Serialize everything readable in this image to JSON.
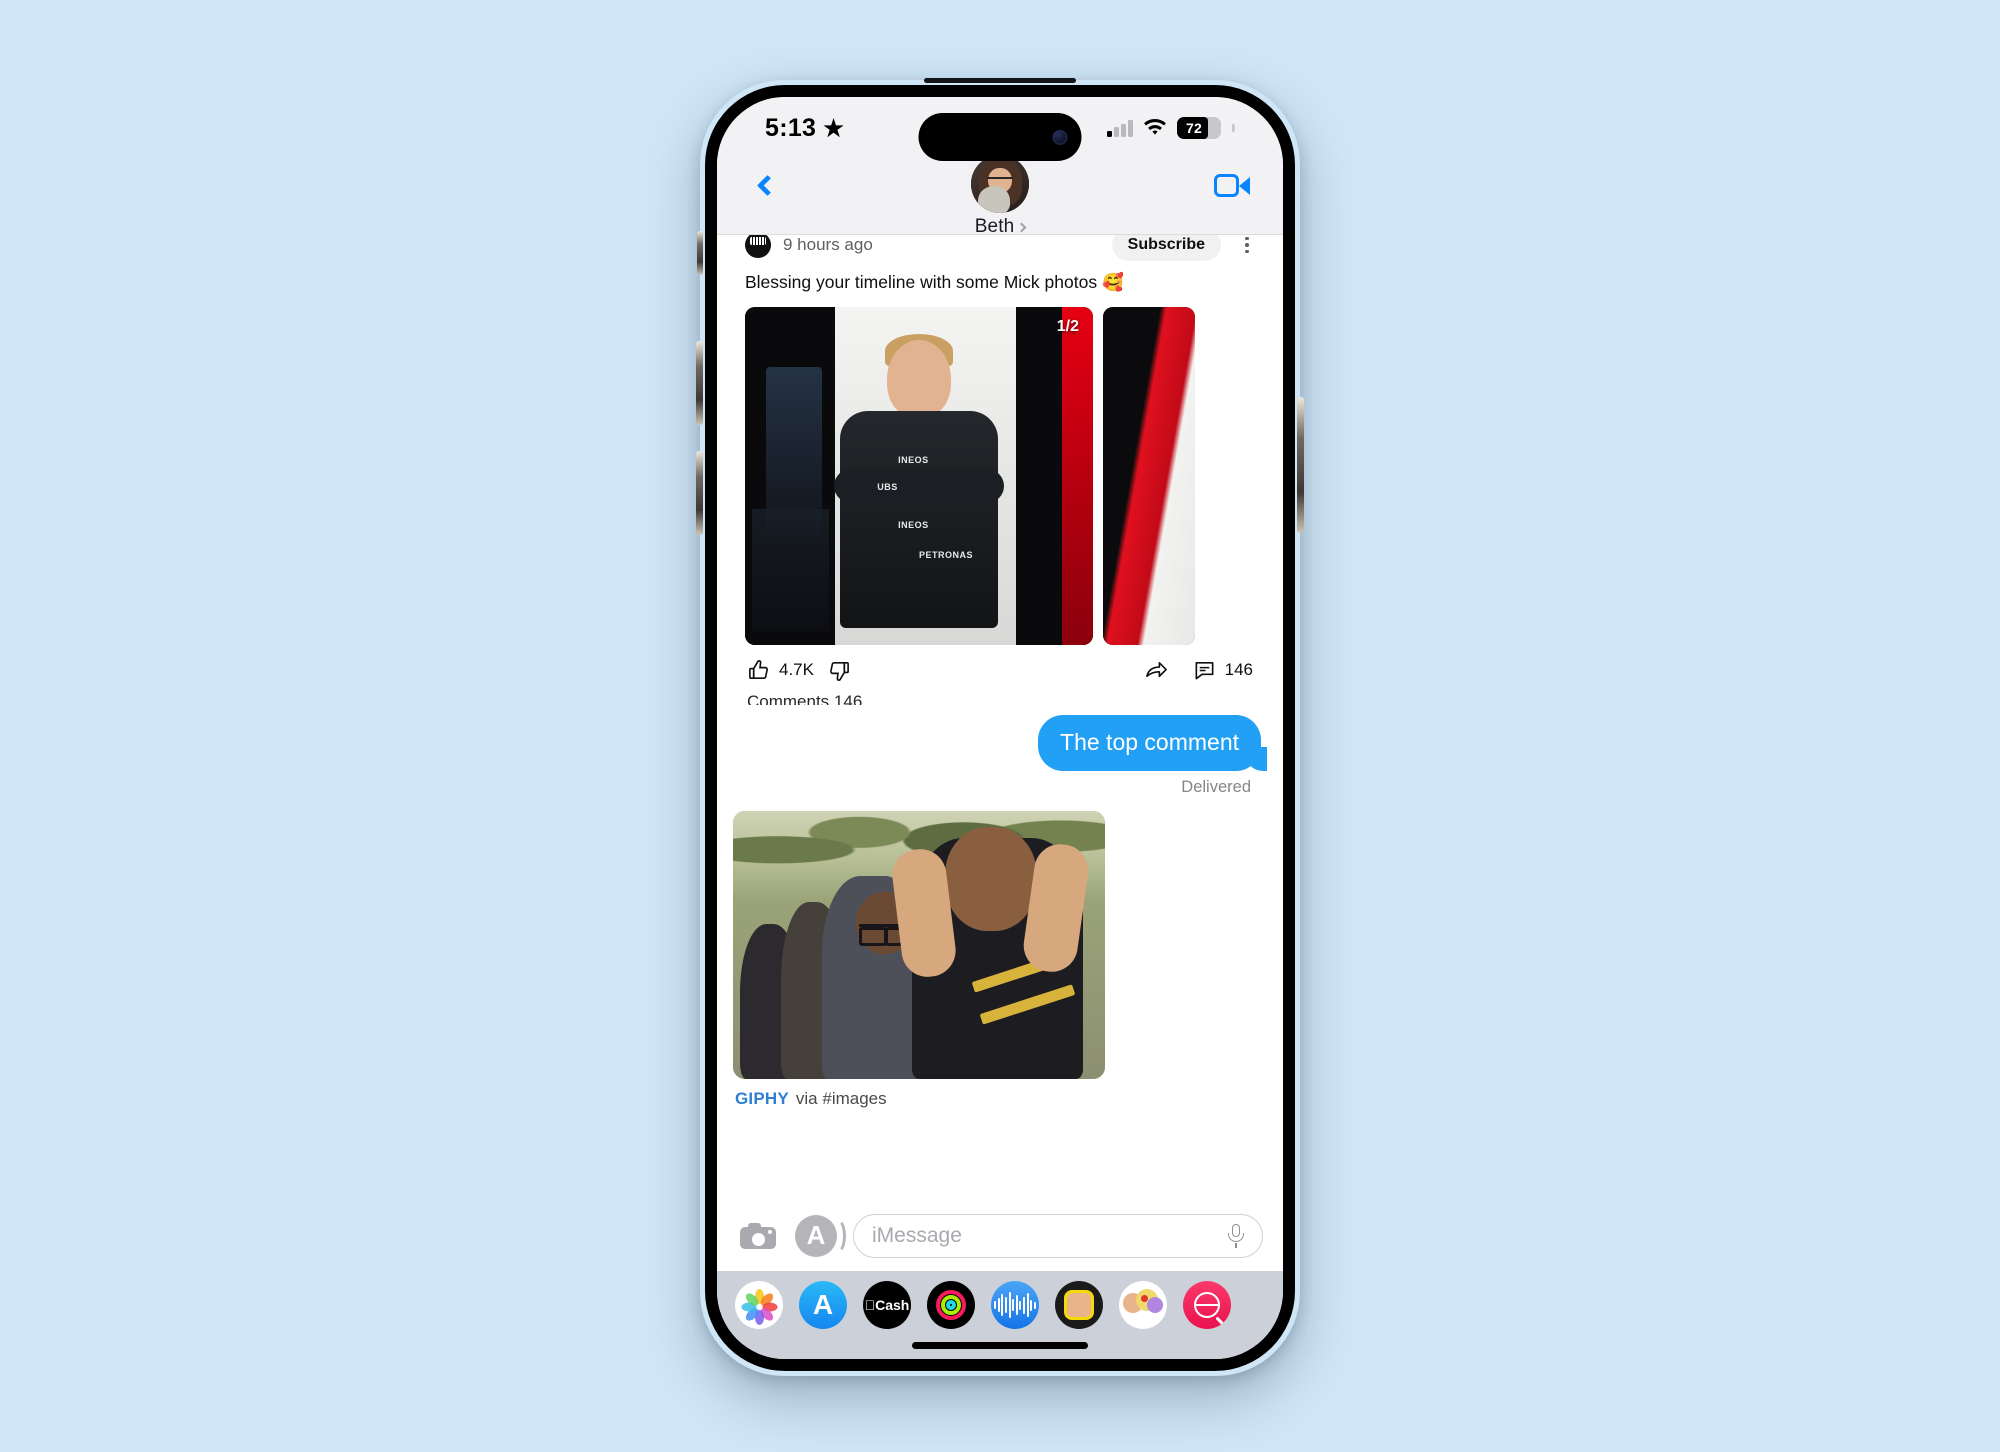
{
  "status_bar": {
    "time": "5:13",
    "focus_icon": "star-icon",
    "signal_icon": "cellular-signal-icon",
    "wifi_icon": "wifi-icon",
    "battery_level": "72",
    "battery_icon": "battery-icon"
  },
  "header": {
    "back_icon": "chevron-left-icon",
    "contact_name": "Beth",
    "contact_chevron_icon": "chevron-right-icon",
    "avatar_icon": "contact-avatar",
    "facetime_icon": "video-camera-icon"
  },
  "youtube_post": {
    "channel_avatar_icon": "channel-avatar-icon",
    "timestamp": "9 hours ago",
    "subscribe_label": "Subscribe",
    "kebab_icon": "more-options-icon",
    "post_text": "Blessing your timeline with some Mick photos 🥰",
    "carousel_indicator": "1/2",
    "like_icon": "thumbs-up-icon",
    "like_count": "4.7K",
    "dislike_icon": "thumbs-down-icon",
    "share_icon": "share-arrow-icon",
    "comment_icon": "comment-bubble-icon",
    "comment_count": "146",
    "comments_label_cut": "Comments  146"
  },
  "outgoing_message": {
    "text": "The top comment",
    "status": "Delivered",
    "bubble_color": "#22a0f5"
  },
  "giphy_message": {
    "brand": "GIPHY",
    "via": "via #images"
  },
  "input_bar": {
    "camera_icon": "camera-icon",
    "appstore_icon": "app-store-icon",
    "placeholder": "iMessage",
    "value": "",
    "mic_icon": "microphone-icon"
  },
  "app_drawer": {
    "items": [
      {
        "name": "photos",
        "icon": "photos-app-icon",
        "label": ""
      },
      {
        "name": "app-store",
        "icon": "app-store-app-icon",
        "label": "A"
      },
      {
        "name": "apple-cash",
        "icon": "apple-cash-app-icon",
        "label": "Cash"
      },
      {
        "name": "fitness",
        "icon": "fitness-rings-app-icon",
        "label": ""
      },
      {
        "name": "voice-memos",
        "icon": "voice-memos-app-icon",
        "label": ""
      },
      {
        "name": "memoji",
        "icon": "memoji-app-icon",
        "label": ""
      },
      {
        "name": "memoji-stickers",
        "icon": "memoji-stickers-app-icon",
        "label": ""
      },
      {
        "name": "images-gif",
        "icon": "gif-search-app-icon",
        "label": ""
      }
    ]
  },
  "colors": {
    "page_background": "#cfe6f7",
    "bubble_blue": "#22a0f5",
    "accent_blue": "#0a84ff",
    "drawer_gray": "#ccd0d8",
    "header_gray": "#f2f2f4"
  }
}
